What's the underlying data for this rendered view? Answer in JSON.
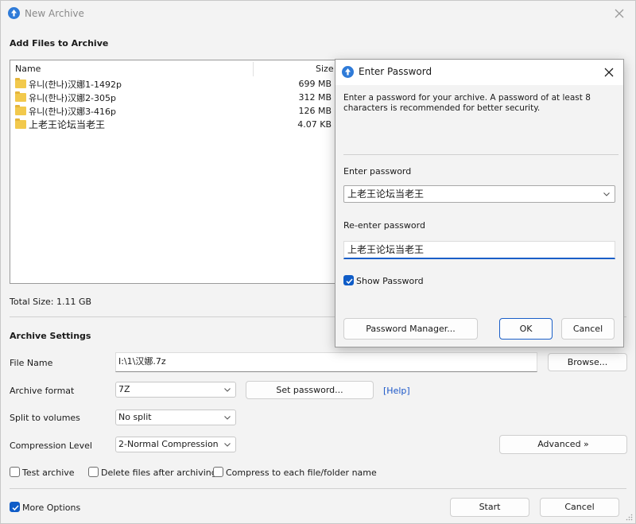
{
  "window": {
    "title": "New Archive",
    "icon": "app-logo-icon"
  },
  "files_section": {
    "heading": "Add Files to Archive",
    "columns": {
      "name": "Name",
      "size": "Size"
    },
    "rows": [
      {
        "name": "유니(한나)汉娜1-1492p",
        "size": "699 MB",
        "icon": "folder-icon"
      },
      {
        "name": "유니(한나)汉娜2-305p",
        "size": "312 MB",
        "icon": "folder-icon"
      },
      {
        "name": "유니(한나)汉娜3-416p",
        "size": "126 MB",
        "icon": "folder-icon"
      },
      {
        "name": "上老王论坛当老王",
        "size": "4.07 KB",
        "icon": "folder-icon"
      }
    ],
    "total_size": "Total Size: 1.11 GB"
  },
  "archive_settings": {
    "heading": "Archive Settings",
    "file_name_label": "File Name",
    "file_name_value": "I:\\1\\汉娜.7z",
    "browse_label": "Browse...",
    "format_label": "Archive format",
    "format_value": "7Z",
    "set_password_label": "Set password...",
    "help_link": "[Help]",
    "split_label": "Split to volumes",
    "split_value": "No split",
    "compression_label": "Compression Level",
    "compression_value": "2-Normal Compression",
    "advanced_label": "Advanced »",
    "test_archive_label": "Test archive",
    "delete_after_label": "Delete files after archiving",
    "compress_each_label": "Compress to each file/folder name",
    "more_options_label": "More Options",
    "start_label": "Start",
    "cancel_label": "Cancel"
  },
  "password_dialog": {
    "title": "Enter Password",
    "description": "Enter a password for your archive. A password of at least 8 characters is recommended for better security.",
    "enter_label": "Enter password",
    "enter_value": "上老王论坛当老王",
    "reenter_label": "Re-enter password",
    "reenter_value": "上老王论坛当老王",
    "show_password_label": "Show Password",
    "manager_label": "Password Manager...",
    "ok_label": "OK",
    "cancel_label": "Cancel"
  },
  "colors": {
    "accent": "#0f5cc7",
    "link": "#1a56c8",
    "window_bg": "#f3f3f3"
  }
}
